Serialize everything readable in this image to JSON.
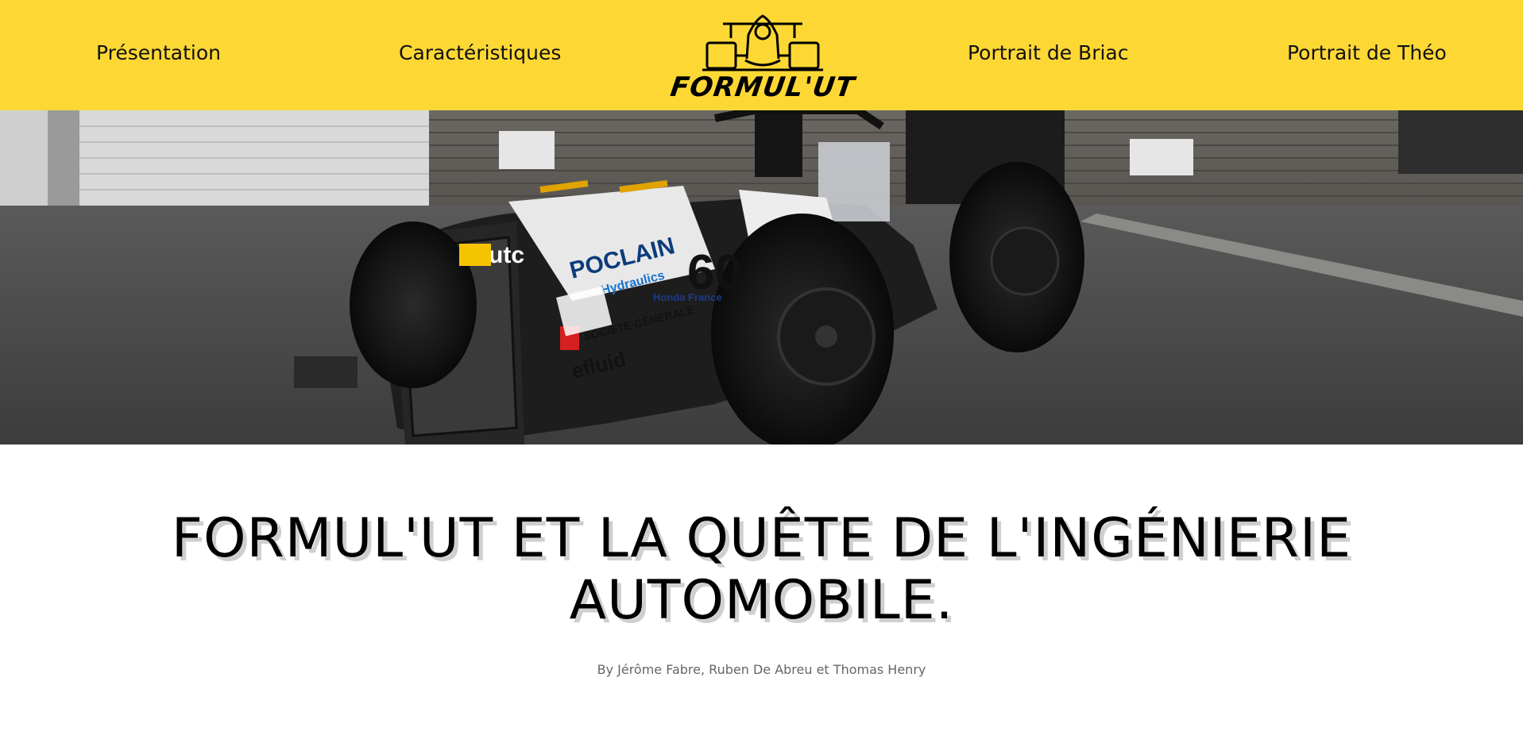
{
  "nav": {
    "items": [
      {
        "label": "Présentation"
      },
      {
        "label": "Caractéristiques"
      },
      {
        "label": "Portrait de Briac"
      },
      {
        "label": "Portrait de Théo"
      }
    ],
    "logo_text": "FORMUL'UT",
    "background_color": "#fdd835"
  },
  "hero": {
    "car_stickers": {
      "brand_1": "utc",
      "brand_2": "POCLAIN",
      "brand_2_sub": "Hydraulics",
      "brand_3": "SOCIETE GENERALE",
      "brand_4": "efluid",
      "brand_5": "Honda France",
      "race_number": "60"
    }
  },
  "article": {
    "title": "FORMUL'UT ET LA QUÊTE DE L'INGÉNIERIE AUTOMOBILE.",
    "byline": "By Jérôme Fabre, Ruben De Abreu et Thomas Henry"
  }
}
